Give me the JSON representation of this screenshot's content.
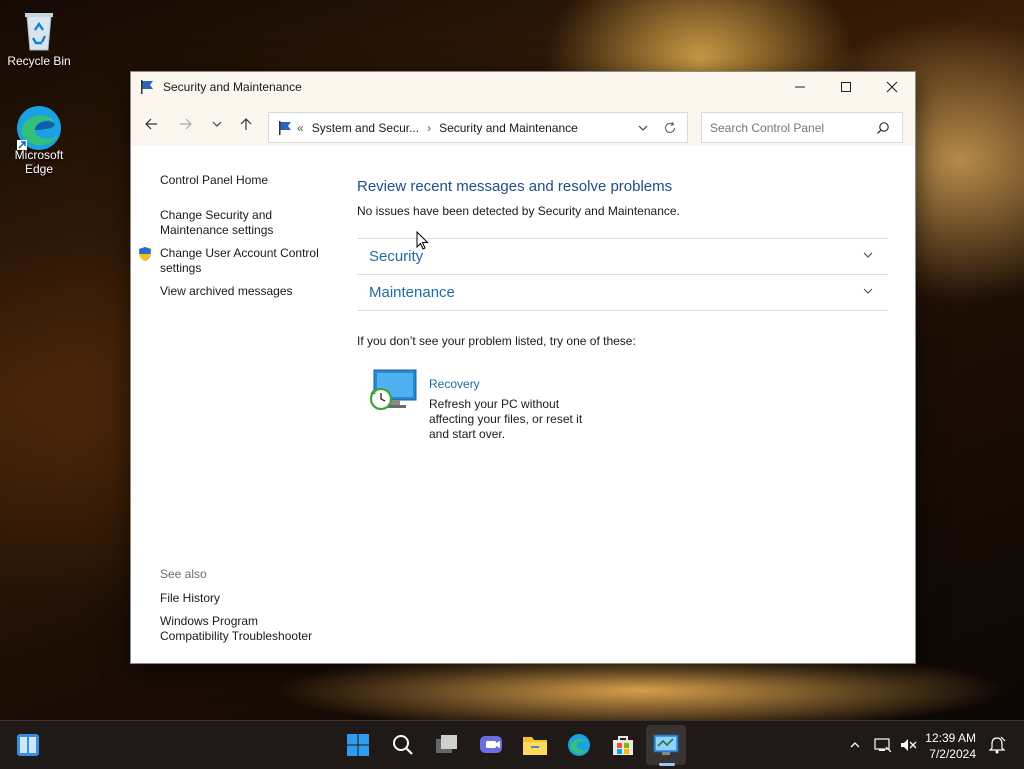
{
  "desktop": {
    "icons": [
      {
        "label": "Recycle Bin"
      },
      {
        "label": "Microsoft Edge"
      }
    ]
  },
  "window": {
    "title": "Security and Maintenance",
    "address": {
      "overflow": "«",
      "crumbs": [
        "System and Secur...",
        "Security and Maintenance"
      ],
      "separator": "›"
    },
    "search": {
      "placeholder": "Search Control Panel"
    },
    "help_label": "?"
  },
  "sidebar": {
    "home": "Control Panel Home",
    "links": [
      "Change Security and Maintenance settings",
      "Change User Account Control settings",
      "View archived messages"
    ],
    "see_also_heading": "See also",
    "see_also": [
      "File History",
      "Windows Program Compatibility Troubleshooter"
    ]
  },
  "main": {
    "title": "Review recent messages and resolve problems",
    "status": "No issues have been detected by Security and Maintenance.",
    "sections": [
      "Security",
      "Maintenance"
    ],
    "hint": "If you don’t see your problem listed, try one of these:",
    "recovery": {
      "title": "Recovery",
      "description": "Refresh your PC without affecting your files, or reset it and start over."
    }
  },
  "taskbar": {
    "time": "12:39 AM",
    "date": "7/2/2024"
  },
  "colors": {
    "accent_link": "#1e6aa8",
    "title_blue": "#1e4e8c",
    "taskbar": "#1f1a17"
  }
}
